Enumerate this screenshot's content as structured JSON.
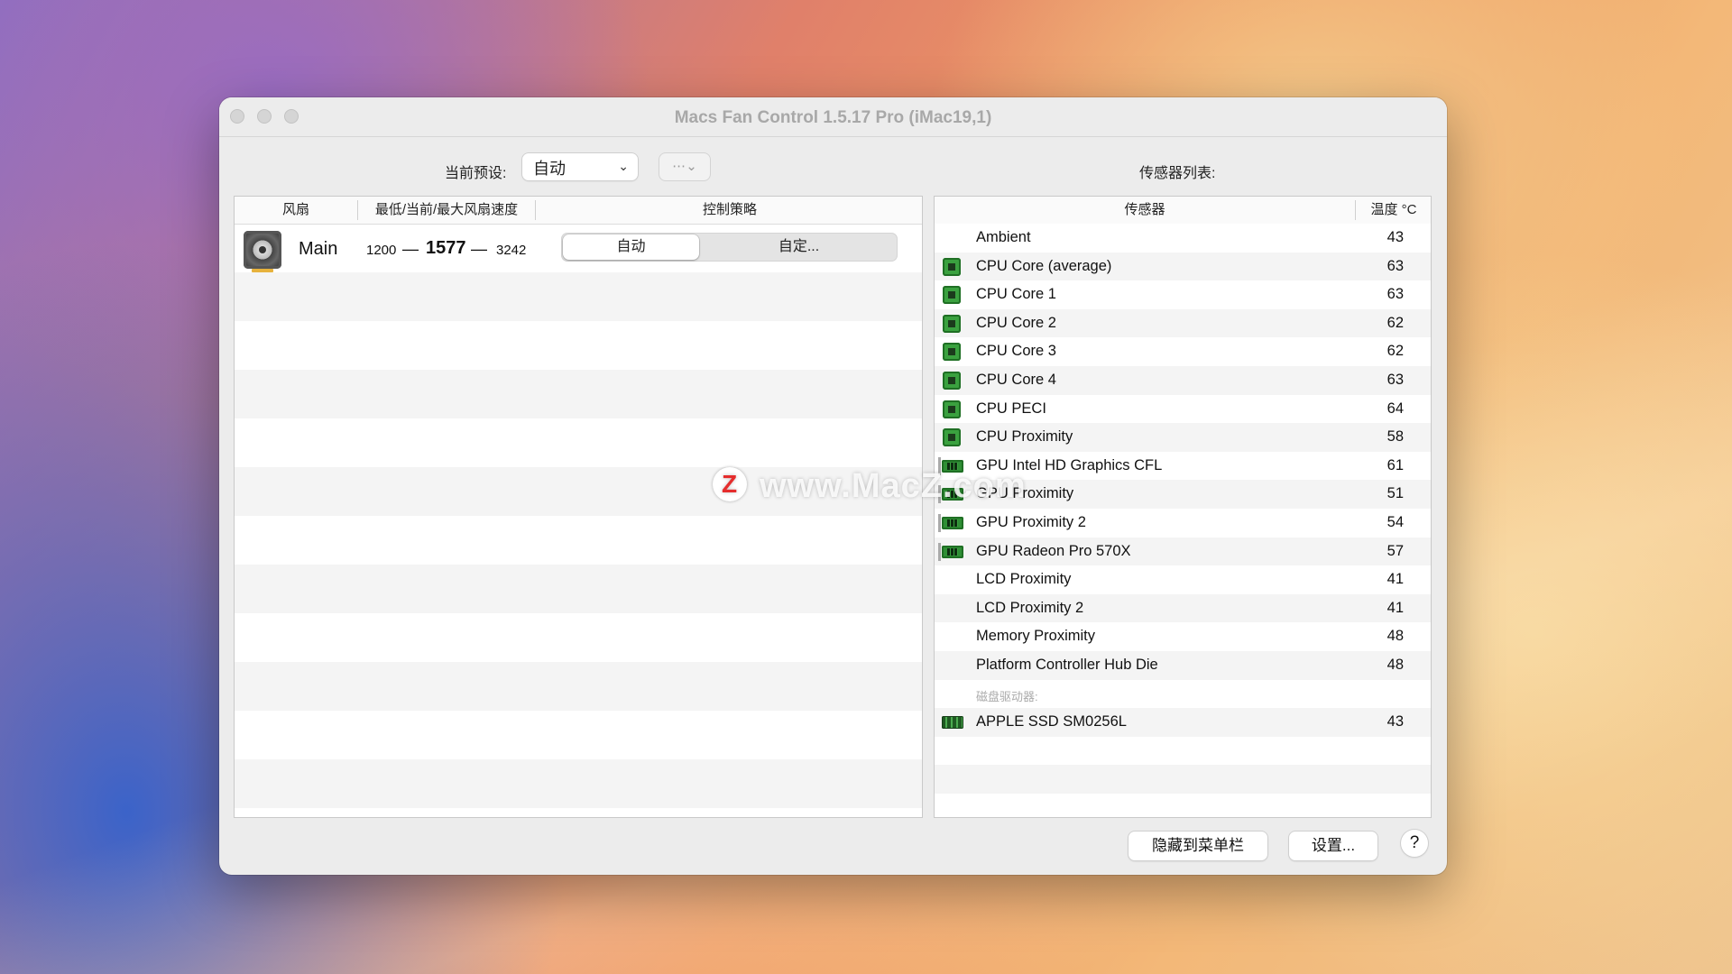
{
  "window": {
    "title": "Macs Fan Control 1.5.17 Pro (iMac19,1)"
  },
  "toolbar": {
    "preset_label": "当前预设:",
    "preset_value": "自动",
    "more_icon": "ellipsis-circle-icon",
    "sensor_list_label": "传感器列表:"
  },
  "fan_table": {
    "headers": [
      "风扇",
      "最低/当前/最大风扇速度",
      "控制策略"
    ],
    "rows": [
      {
        "name": "Main",
        "min": "1200",
        "dash1": "—",
        "current": "1577",
        "dash2": "—",
        "max": "3242",
        "mode_auto": "自动",
        "mode_custom": "自定..."
      }
    ]
  },
  "sensor_table": {
    "headers": [
      "传感器",
      "温度 °C"
    ],
    "rows": [
      {
        "name": "Ambient",
        "value": "43",
        "icon": "none"
      },
      {
        "name": "CPU Core (average)",
        "value": "63",
        "icon": "cpu-chip-icon"
      },
      {
        "name": "CPU Core 1",
        "value": "63",
        "icon": "cpu-chip-icon"
      },
      {
        "name": "CPU Core 2",
        "value": "62",
        "icon": "cpu-chip-icon"
      },
      {
        "name": "CPU Core 3",
        "value": "62",
        "icon": "cpu-chip-icon"
      },
      {
        "name": "CPU Core 4",
        "value": "63",
        "icon": "cpu-chip-icon"
      },
      {
        "name": "CPU PECI",
        "value": "64",
        "icon": "cpu-chip-icon"
      },
      {
        "name": "CPU Proximity",
        "value": "58",
        "icon": "cpu-chip-icon"
      },
      {
        "name": "GPU Intel HD Graphics CFL",
        "value": "61",
        "icon": "gpu-card-icon"
      },
      {
        "name": "GPU Proximity",
        "value": "51",
        "icon": "gpu-card-icon"
      },
      {
        "name": "GPU Proximity 2",
        "value": "54",
        "icon": "gpu-card-icon"
      },
      {
        "name": "GPU Radeon Pro 570X",
        "value": "57",
        "icon": "gpu-card-icon"
      },
      {
        "name": "LCD Proximity",
        "value": "41",
        "icon": "none"
      },
      {
        "name": "LCD Proximity 2",
        "value": "41",
        "icon": "none"
      },
      {
        "name": "Memory Proximity",
        "value": "48",
        "icon": "none"
      },
      {
        "name": "Platform Controller Hub Die",
        "value": "48",
        "icon": "none"
      }
    ],
    "disk_section_label": "磁盘驱动器:",
    "disk_rows": [
      {
        "name": "APPLE SSD SM0256L",
        "value": "43",
        "icon": "ssd-icon"
      }
    ]
  },
  "bottom": {
    "hide_to_menubar": "隐藏到菜单栏",
    "settings": "设置...",
    "help": "?"
  },
  "watermark": {
    "logo_letter": "Z",
    "text": "www.MacZ.com"
  }
}
